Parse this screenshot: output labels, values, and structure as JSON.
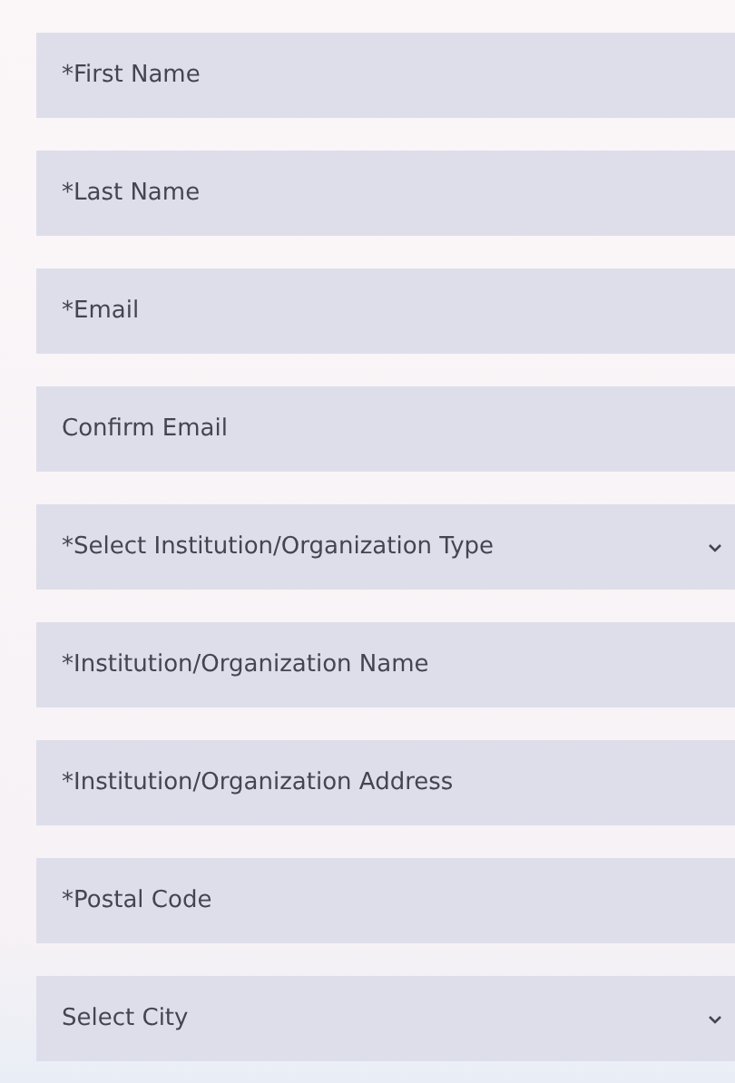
{
  "fields": [
    {
      "kind": "text",
      "placeholder": "*First Name"
    },
    {
      "kind": "text",
      "placeholder": "*Last Name"
    },
    {
      "kind": "text",
      "placeholder": "*Email"
    },
    {
      "kind": "text",
      "placeholder": "Confirm Email"
    },
    {
      "kind": "select",
      "placeholder": "*Select Institution/Organization Type"
    },
    {
      "kind": "text",
      "placeholder": "*Institution/Organization Name"
    },
    {
      "kind": "text",
      "placeholder": "*Institution/Organization Address"
    },
    {
      "kind": "text",
      "placeholder": "*Postal Code"
    },
    {
      "kind": "select",
      "placeholder": "Select City"
    }
  ]
}
